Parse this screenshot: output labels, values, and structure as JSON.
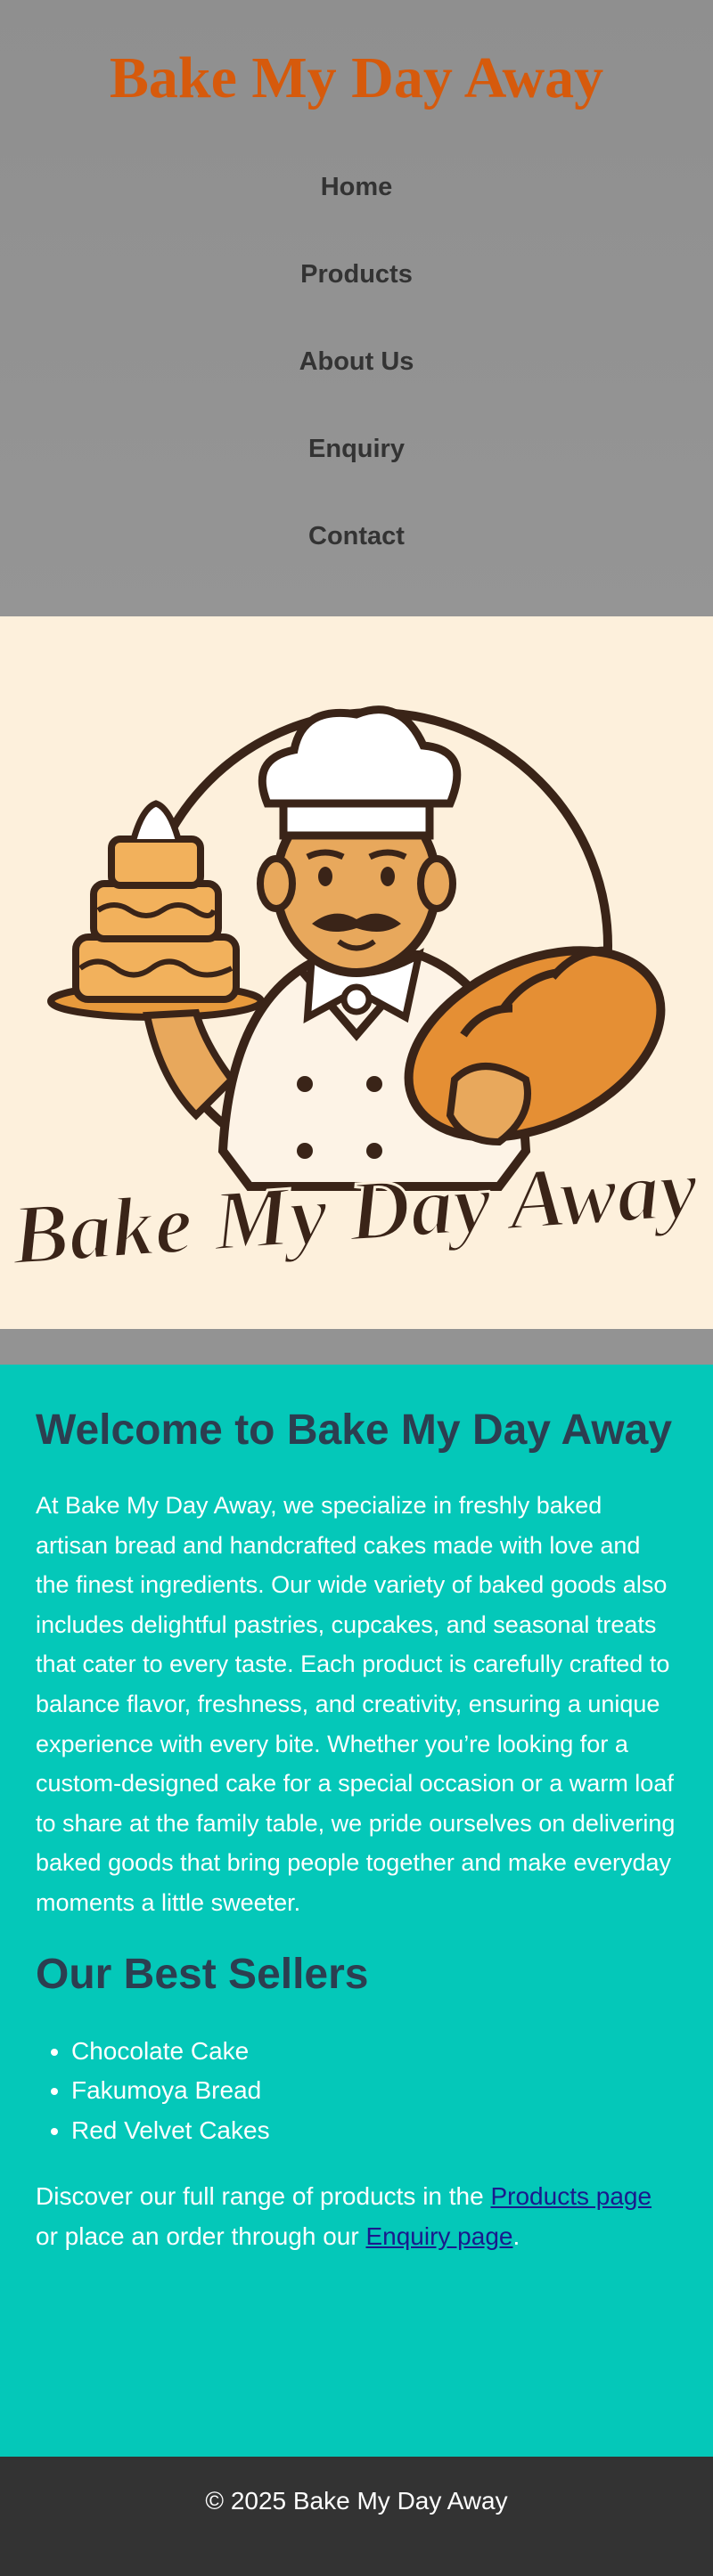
{
  "site": {
    "title": "Bake My Day Away"
  },
  "nav": {
    "items": [
      {
        "label": "Home"
      },
      {
        "label": "Products"
      },
      {
        "label": "About Us"
      },
      {
        "label": "Enquiry"
      },
      {
        "label": "Contact"
      }
    ]
  },
  "hero": {
    "logo_text": "Bake My Day Away",
    "icon": "chef-baker-logo",
    "colors": {
      "background": "#fdf0dc",
      "outline": "#3a2418",
      "accent": "#e89a3c"
    }
  },
  "main": {
    "welcome_heading": "Welcome to Bake My Day Away",
    "intro": "At Bake My Day Away, we specialize in freshly baked artisan bread and handcrafted cakes made with love and the finest ingredients. Our wide variety of baked goods also includes delightful pastries, cupcakes, and seasonal treats that cater to every taste. Each product is carefully crafted to balance flavor, freshness, and creativity, ensuring a unique experience with every bite. Whether you’re looking for a custom-designed cake for a special occasion or a warm loaf to share at the family table, we pride ourselves on delivering baked goods that bring people together and make everyday moments a little sweeter.",
    "best_sellers_heading": "Our Best Sellers",
    "best_sellers": [
      "Chocolate Cake",
      "Fakumoya Bread",
      "Red Velvet Cakes"
    ],
    "discover_prefix": "Discover our full range of products in the ",
    "products_link": "Products page",
    "discover_middle": " or place an order through our ",
    "enquiry_link": "Enquiry page",
    "discover_suffix": "."
  },
  "footer": {
    "text": "© 2025 Bake My Day Away"
  },
  "colors": {
    "header_bg": "#939393",
    "title": "#d65a0c",
    "main_bg": "#04c8b9",
    "heading": "#2c3e50",
    "footer_bg": "#333333"
  }
}
